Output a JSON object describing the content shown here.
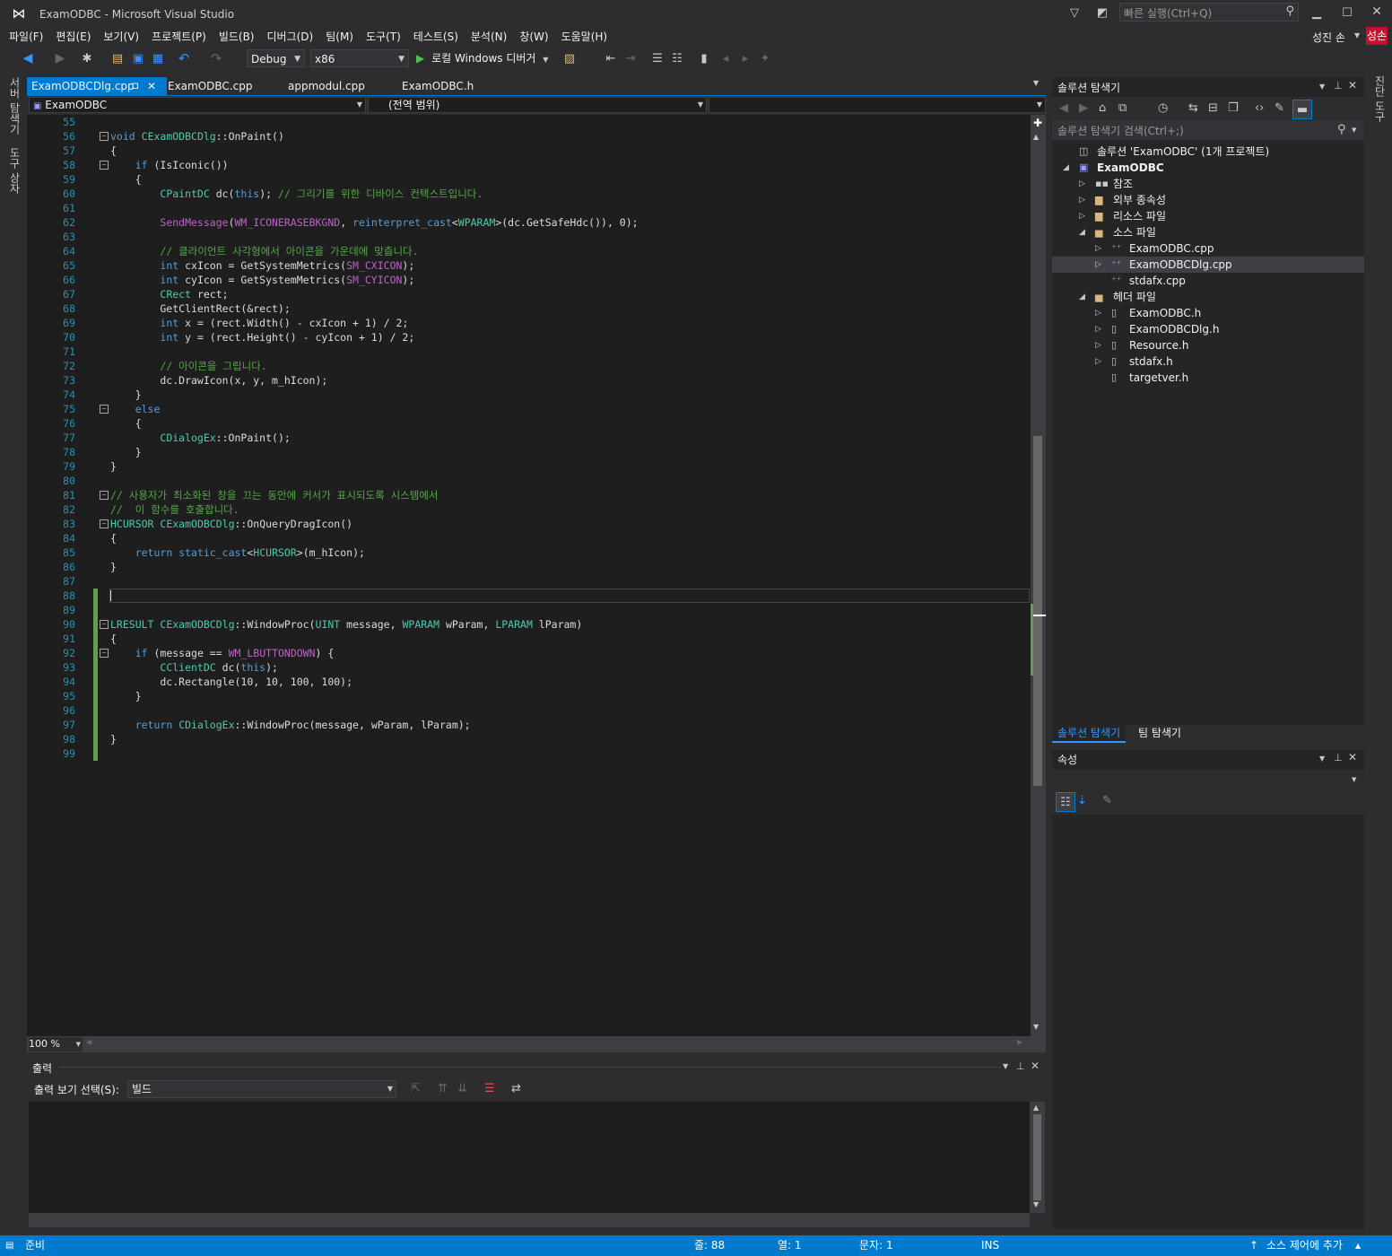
{
  "window": {
    "title": "ExamODBC - Microsoft Visual Studio",
    "quick_launch_placeholder": "빠른 실행(Ctrl+Q)",
    "user": "성진 손",
    "user_badge": "성손"
  },
  "menu": [
    "파일(F)",
    "편집(E)",
    "보기(V)",
    "프로젝트(P)",
    "빌드(B)",
    "디버그(D)",
    "팀(M)",
    "도구(T)",
    "테스트(S)",
    "분석(N)",
    "창(W)",
    "도움말(H)"
  ],
  "toolbar": {
    "config": "Debug",
    "platform": "x86",
    "run_label": "로컬 Windows 디버거"
  },
  "left_strip": [
    "서버 탐색기",
    "도구 상자"
  ],
  "right_strip": [
    "진단 도구"
  ],
  "tabs": [
    {
      "label": "ExamODBCDlg.cpp",
      "active": true
    },
    {
      "label": "ExamODBC.cpp"
    },
    {
      "label": "appmodul.cpp"
    },
    {
      "label": "ExamODBC.h"
    }
  ],
  "nav": {
    "project": "ExamODBC",
    "scope": "(전역 범위)"
  },
  "editor": {
    "zoom": "100 %",
    "lines": [
      {
        "n": "55",
        "t": ""
      },
      {
        "n": "56",
        "t": "void CExamODBCDlg::OnPaint()"
      },
      {
        "n": "57",
        "t": "{"
      },
      {
        "n": "58",
        "t": "    if (IsIconic())"
      },
      {
        "n": "59",
        "t": "    {"
      },
      {
        "n": "60",
        "t": "        CPaintDC dc(this); // 그리기를 위한 디바이스 컨텍스트입니다."
      },
      {
        "n": "61",
        "t": ""
      },
      {
        "n": "62",
        "t": "        SendMessage(WM_ICONERASEBKGND, reinterpret_cast<WPARAM>(dc.GetSafeHdc()), 0);"
      },
      {
        "n": "63",
        "t": ""
      },
      {
        "n": "64",
        "t": "        // 클라이언트 사각형에서 아이콘을 가운데에 맞춥니다."
      },
      {
        "n": "65",
        "t": "        int cxIcon = GetSystemMetrics(SM_CXICON);"
      },
      {
        "n": "66",
        "t": "        int cyIcon = GetSystemMetrics(SM_CYICON);"
      },
      {
        "n": "67",
        "t": "        CRect rect;"
      },
      {
        "n": "68",
        "t": "        GetClientRect(&rect);"
      },
      {
        "n": "69",
        "t": "        int x = (rect.Width() - cxIcon + 1) / 2;"
      },
      {
        "n": "70",
        "t": "        int y = (rect.Height() - cyIcon + 1) / 2;"
      },
      {
        "n": "71",
        "t": ""
      },
      {
        "n": "72",
        "t": "        // 아이콘을 그립니다."
      },
      {
        "n": "73",
        "t": "        dc.DrawIcon(x, y, m_hIcon);"
      },
      {
        "n": "74",
        "t": "    }"
      },
      {
        "n": "75",
        "t": "    else"
      },
      {
        "n": "76",
        "t": "    {"
      },
      {
        "n": "77",
        "t": "        CDialogEx::OnPaint();"
      },
      {
        "n": "78",
        "t": "    }"
      },
      {
        "n": "79",
        "t": "}"
      },
      {
        "n": "80",
        "t": ""
      },
      {
        "n": "81",
        "t": "// 사용자가 최소화된 창을 끄는 동안에 커서가 표시되도록 시스템에서"
      },
      {
        "n": "82",
        "t": "//  이 함수를 호출합니다."
      },
      {
        "n": "83",
        "t": "HCURSOR CExamODBCDlg::OnQueryDragIcon()"
      },
      {
        "n": "84",
        "t": "{"
      },
      {
        "n": "85",
        "t": "    return static_cast<HCURSOR>(m_hIcon);"
      },
      {
        "n": "86",
        "t": "}"
      },
      {
        "n": "87",
        "t": ""
      },
      {
        "n": "88",
        "t": ""
      },
      {
        "n": "89",
        "t": ""
      },
      {
        "n": "90",
        "t": "LRESULT CExamODBCDlg::WindowProc(UINT message, WPARAM wParam, LPARAM lParam)"
      },
      {
        "n": "91",
        "t": "{"
      },
      {
        "n": "92",
        "t": "    if (message == WM_LBUTTONDOWN) {"
      },
      {
        "n": "93",
        "t": "        CClientDC dc(this);"
      },
      {
        "n": "94",
        "t": "        dc.Rectangle(10, 10, 100, 100);"
      },
      {
        "n": "95",
        "t": "    }"
      },
      {
        "n": "96",
        "t": ""
      },
      {
        "n": "97",
        "t": "    return CDialogEx::WindowProc(message, wParam, lParam);"
      },
      {
        "n": "98",
        "t": "}"
      },
      {
        "n": "99",
        "t": ""
      }
    ]
  },
  "output": {
    "title": "출력",
    "source_label": "출력 보기 선택(S):",
    "source_value": "빌드"
  },
  "solution_explorer": {
    "title": "솔루션 탐색기",
    "search_placeholder": "솔루션 탐색기 검색(Ctrl+;)",
    "items": [
      {
        "label": "솔루션 'ExamODBC' (1개 프로젝트)",
        "level": 0,
        "expand": "",
        "icon": "solution"
      },
      {
        "label": "ExamODBC",
        "level": 0,
        "expand": "open",
        "icon": "project",
        "bold": true
      },
      {
        "label": "참조",
        "level": 1,
        "expand": "closed",
        "icon": "references"
      },
      {
        "label": "외부 종속성",
        "level": 1,
        "expand": "closed",
        "icon": "folder"
      },
      {
        "label": "리소스 파일",
        "level": 1,
        "expand": "closed",
        "icon": "folder"
      },
      {
        "label": "소스 파일",
        "level": 1,
        "expand": "open",
        "icon": "folder-open"
      },
      {
        "label": "ExamODBC.cpp",
        "level": 2,
        "expand": "closed",
        "icon": "cpp"
      },
      {
        "label": "ExamODBCDlg.cpp",
        "level": 2,
        "expand": "closed",
        "icon": "cpp",
        "selected": true
      },
      {
        "label": "stdafx.cpp",
        "level": 2,
        "expand": "",
        "icon": "cpp"
      },
      {
        "label": "헤더 파일",
        "level": 1,
        "expand": "open",
        "icon": "folder-open"
      },
      {
        "label": "ExamODBC.h",
        "level": 2,
        "expand": "closed",
        "icon": "header"
      },
      {
        "label": "ExamODBCDlg.h",
        "level": 2,
        "expand": "closed",
        "icon": "header"
      },
      {
        "label": "Resource.h",
        "level": 2,
        "expand": "closed",
        "icon": "header"
      },
      {
        "label": "stdafx.h",
        "level": 2,
        "expand": "closed",
        "icon": "header"
      },
      {
        "label": "targetver.h",
        "level": 2,
        "expand": "",
        "icon": "header"
      }
    ],
    "bottom_tabs": [
      "솔루션 탐색기",
      "팀 탐색기"
    ]
  },
  "properties": {
    "title": "속성"
  },
  "status": {
    "ready": "준비",
    "line": "줄: 88",
    "col": "열: 1",
    "char": "문자: 1",
    "mode": "INS",
    "source_control": "소스 제어에 추가"
  }
}
